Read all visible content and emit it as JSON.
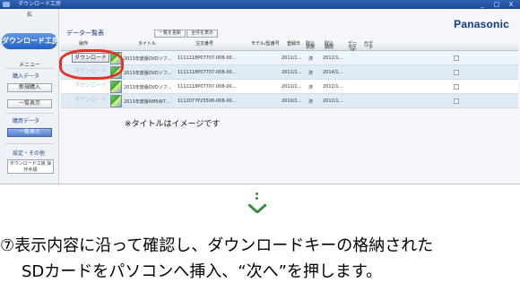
{
  "window": {
    "title": "ダウンロード工房",
    "controls": [
      "_",
      "□",
      "X"
    ],
    "brand": "Panasonic"
  },
  "sidebar": {
    "top_label": "拡",
    "logo": "ダウンロード工房",
    "menu_label": "メニュー",
    "section_add": "購入データ",
    "btn_new": "新規購入",
    "btn_list": "一覧表示",
    "section_purchase": "購買データ",
    "btn_active": "一覧表示",
    "section_settings": "設定・その他",
    "btn_manual": "ダウンロード工房 操作手順"
  },
  "main": {
    "panel_title": "データ一覧表",
    "btn_refresh": "一覧を更新",
    "btn_all": "全件を表示",
    "columns": [
      "操作",
      "",
      "タイトル",
      "注文番号",
      "モデル/型番号",
      "登録日",
      "取込状態",
      "取込期限",
      "データ区分",
      "元データ",
      "選択"
    ],
    "rows": [
      {
        "action": "ダウンロード",
        "title": "2013年度版DVDソフ...",
        "order": "1111118P07707-008-00...",
        "date": "2011/1...",
        "state": "済",
        "limit": "2012/1..."
      },
      {
        "action": "ダウンロード",
        "title": "2013年度版DVDソフ...",
        "order": "1111118P07707-008-00...",
        "date": "2011/1...",
        "state": "済",
        "limit": "2014/1..."
      },
      {
        "action": "ダウンロード",
        "title": "2013年度版DVDソフ...",
        "order": "1111118P07707-008-00...",
        "date": "2011/1...",
        "state": "済",
        "limit": "2012/1..."
      },
      {
        "action": "ダウンロード",
        "title": "2013年度版RM5W7...",
        "order": "1112077P25506-008-00...",
        "date": "2010/1...",
        "state": "済",
        "limit": "2012/1..."
      }
    ],
    "note": "※タイトルはイメージです"
  },
  "caption": {
    "line1": "⑦表示内容に沿って確認し、ダウンロードキーの格納された",
    "line2": "SDカードをパソコンへ挿入、“次へ”を押します。"
  },
  "colors": {
    "accent": "#2462c7",
    "highlight_ring": "#e0342b",
    "arrow": "#3c8b40"
  }
}
